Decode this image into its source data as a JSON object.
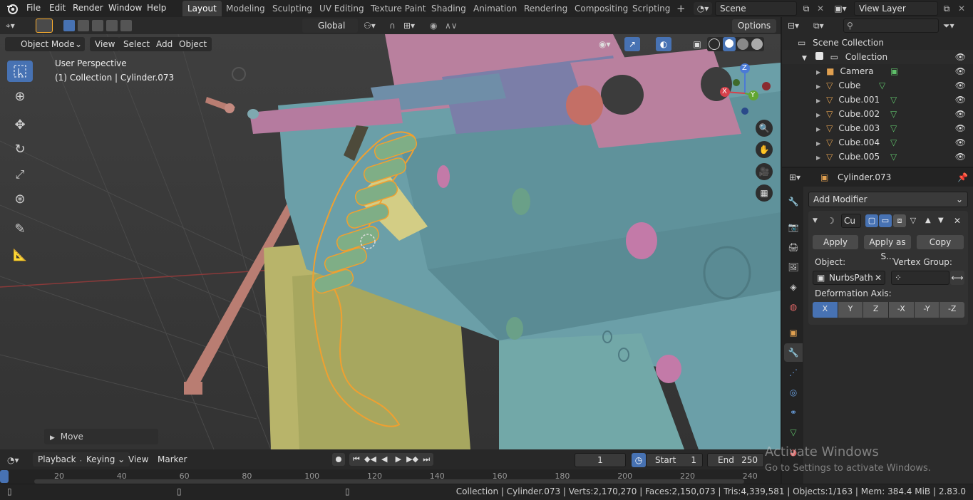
{
  "topbar": {
    "menus": [
      "File",
      "Edit",
      "Render",
      "Window",
      "Help"
    ],
    "workspaces": [
      "Layout",
      "Modeling",
      "Sculpting",
      "UV Editing",
      "Texture Paint",
      "Shading",
      "Animation",
      "Rendering",
      "Compositing",
      "Scripting"
    ],
    "active_workspace": "Layout",
    "add_tab": "+",
    "scene": "Scene",
    "view_layer": "View Layer"
  },
  "viewport_header": {
    "orientation": "Global",
    "options": "Options",
    "mode": "Object Mode",
    "menus": [
      "View",
      "Select",
      "Add",
      "Object"
    ]
  },
  "viewport": {
    "perspective": "User Perspective",
    "collection_info": "(1) Collection | Cylinder.073",
    "gizmo_x": "X",
    "gizmo_y": "Y",
    "gizmo_z": "Z",
    "last_op": "Move"
  },
  "outliner": {
    "root": "Scene Collection",
    "collection": "Collection",
    "items": [
      "Camera",
      "Cube",
      "Cube.001",
      "Cube.002",
      "Cube.003",
      "Cube.004",
      "Cube.005"
    ]
  },
  "properties": {
    "object_name": "Cylinder.073",
    "add_modifier": "Add Modifier",
    "modifier_name": "Cu",
    "apply": "Apply",
    "apply_as": "Apply as S...",
    "copy": "Copy",
    "object_label": "Object:",
    "object_value": "NurbsPath",
    "vertex_group_label": "Vertex Group:",
    "deformation_axis_label": "Deformation Axis:",
    "axes": [
      "X",
      "Y",
      "Z",
      "-X",
      "-Y",
      "-Z"
    ],
    "active_axis": "X"
  },
  "timeline": {
    "menus": [
      "Playback",
      "Keying",
      "View",
      "Marker"
    ],
    "current_frame": "1",
    "start_label": "Start",
    "start": "1",
    "end_label": "End",
    "end": "250",
    "ruler": [
      "20",
      "40",
      "60",
      "80",
      "100",
      "120",
      "140",
      "160",
      "180",
      "200",
      "220",
      "240"
    ],
    "playhead_value": 1
  },
  "statusbar": {
    "text": "Collection | Cylinder.073 | Verts:2,170,270 | Faces:2,150,073 | Tris:4,339,581 | Objects:1/163 | Mem: 384.4 MiB | 2.83.0"
  },
  "watermark": {
    "line1": "Activate Windows",
    "line2": "Go to Settings to activate Windows."
  },
  "colors": {
    "accent": "#4772b3",
    "selection_outline": "#f0a030",
    "header_bg": "#232323",
    "panel_bg": "#2b2b2b"
  }
}
